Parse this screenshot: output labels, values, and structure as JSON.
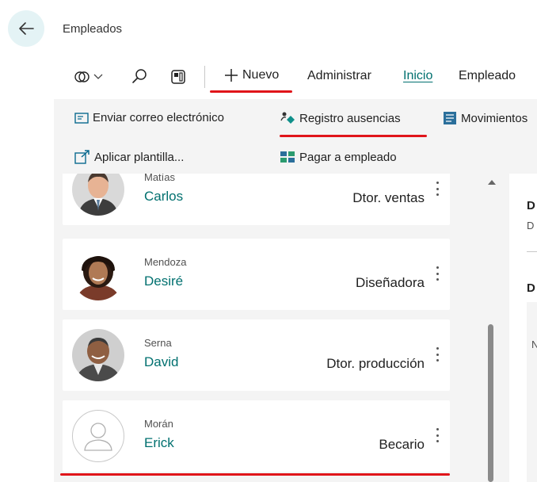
{
  "page": {
    "title": "Empleados"
  },
  "command_bar": {
    "items": [
      {
        "label": "Nuevo"
      },
      {
        "label": "Administrar"
      },
      {
        "label": "Inicio"
      },
      {
        "label": "Empleado"
      }
    ],
    "icons": [
      "switch-icon",
      "search-icon",
      "layout-icon"
    ]
  },
  "actions": [
    {
      "label": "Enviar correo electrónico",
      "icon": "email-icon"
    },
    {
      "label": "Registro ausencias",
      "icon": "absence-icon"
    },
    {
      "label": "Movimientos",
      "icon": "ledger-icon"
    },
    {
      "label": "Aplicar plantilla...",
      "icon": "template-icon"
    },
    {
      "label": "Pagar a empleado",
      "icon": "pay-icon"
    }
  ],
  "employees": [
    {
      "surname": "Matías",
      "name": "Carlos",
      "job": "Dtor. ventas"
    },
    {
      "surname": "Mendoza",
      "name": "Desiré",
      "job": "Diseñadora"
    },
    {
      "surname": "Serna",
      "name": "David",
      "job": "Dtor. producción"
    },
    {
      "surname": "Morán",
      "name": "Erick",
      "job": "Becario"
    }
  ],
  "detail": {
    "heading1": "D",
    "line1": "D",
    "heading2": "D",
    "line2": "N"
  },
  "colors": {
    "accent": "#00706f",
    "highlight": "#e0151a",
    "back_button_bg": "#e4f3f5"
  }
}
